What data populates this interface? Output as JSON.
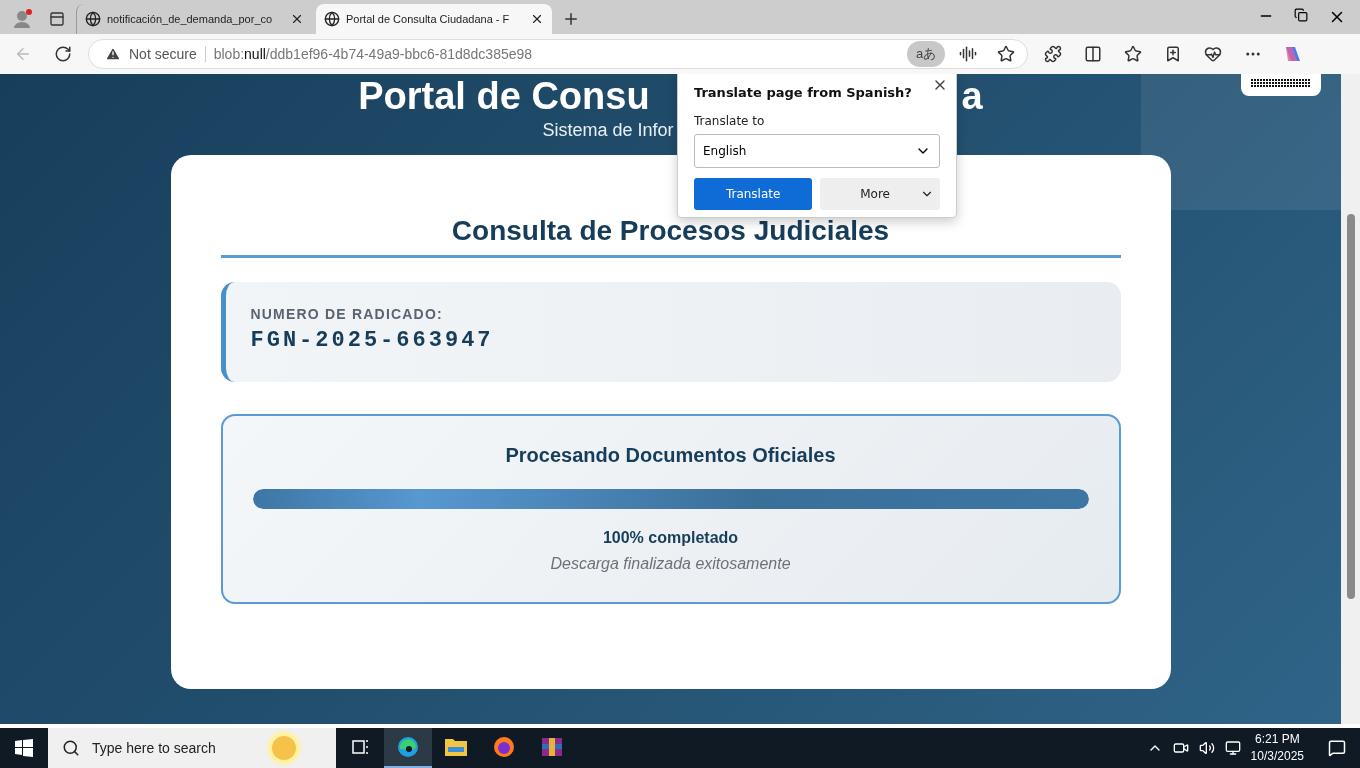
{
  "browser": {
    "tabs": [
      {
        "title": "notificación_de_demanda_por_co",
        "selected": false
      },
      {
        "title": "Portal de Consulta Ciudadana - F",
        "selected": true
      }
    ],
    "address": {
      "security": "Not secure",
      "url": "blob:**null**/ddb1ef96-4b74-49a9-bbc6-81d8dc385e98"
    }
  },
  "translate_icon": "aあ",
  "translate_popup": {
    "title": "Translate page from Spanish?",
    "label": "Translate to",
    "language": "English",
    "primary_button": "Translate",
    "secondary_button": "More"
  },
  "page": {
    "header": {
      "title_parts": [
        "Portal de Consu",
        "a"
      ],
      "subtitle": "Sistema de Infor"
    },
    "card": {
      "heading": "Consulta de Procesos Judiciales",
      "radicado": {
        "label": "NUMERO DE RADICADO:",
        "value": "FGN-2025-663947"
      },
      "progress": {
        "title": "Procesando Documentos Oficiales",
        "level": 1,
        "reading": "100% completado",
        "status": "Descarga finalizada exitosamente"
      }
    }
  },
  "taskbar": {
    "search_placeholder": "Type here to search",
    "apps": [
      {
        "kind": "taskview",
        "selected": false
      },
      {
        "kind": "edge",
        "selected": true
      },
      {
        "kind": "files",
        "selected": false
      },
      {
        "kind": "firefox",
        "selected": false
      },
      {
        "kind": "archive",
        "selected": false
      }
    ],
    "time": "6:21 PM",
    "date": "10/3/2025"
  }
}
